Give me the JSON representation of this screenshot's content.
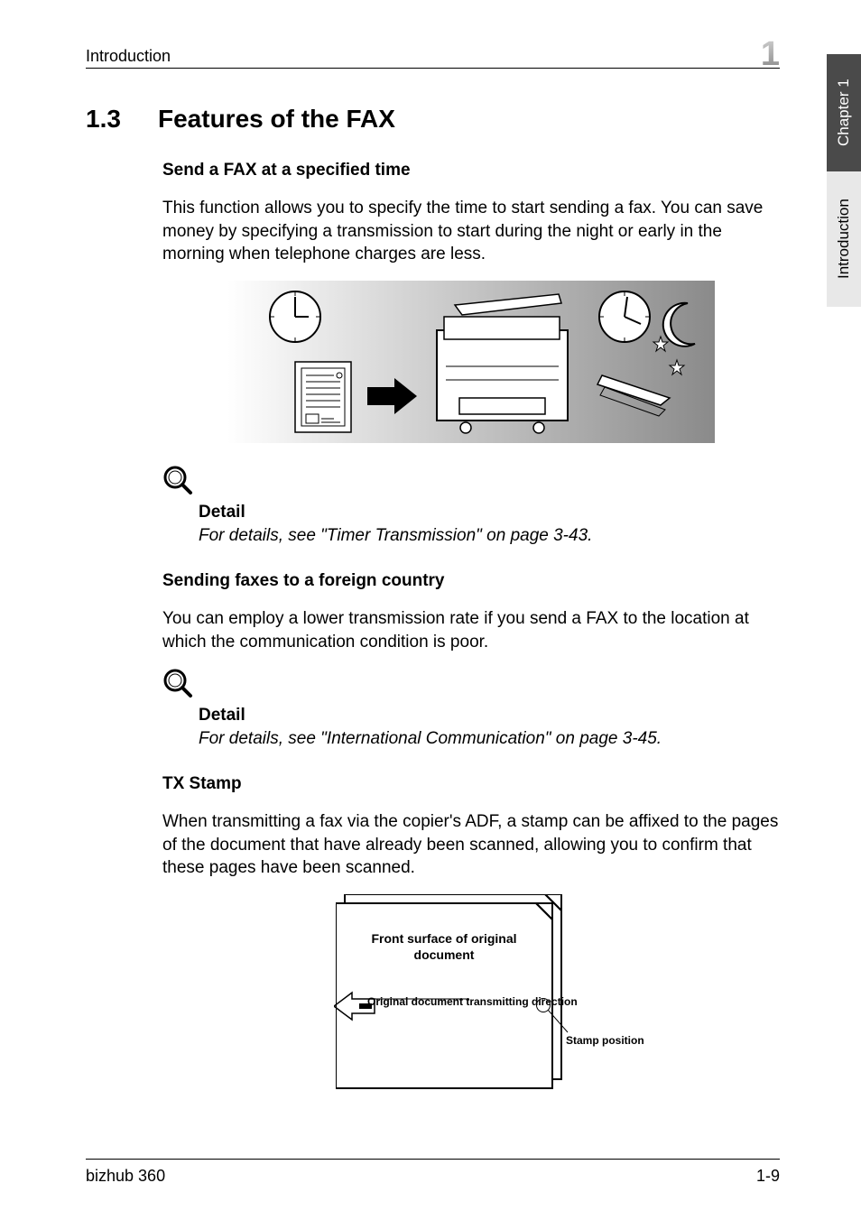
{
  "header": {
    "left": "Introduction",
    "right_number": "1"
  },
  "side_tabs": {
    "chapter": "Chapter 1",
    "section": "Introduction"
  },
  "section": {
    "number": "1.3",
    "title": "Features of the FAX"
  },
  "sub1": {
    "title": "Send a FAX at a specified time",
    "body": "This function allows you to specify the time to start sending a fax. You can save money by specifying a transmission to start during the night or early in the morning when telephone charges are less.",
    "detail_heading": "Detail",
    "detail_text": "For details, see \"Timer Transmission\" on page 3-43."
  },
  "sub2": {
    "title": "Sending faxes to a foreign country",
    "body": "You can employ a lower transmission rate if you send a FAX to the location at which the communication condition is poor.",
    "detail_heading": "Detail",
    "detail_text": "For details, see \"International Communication\" on page 3-45."
  },
  "sub3": {
    "title": "TX Stamp",
    "body": "When transmitting a fax via the copier's ADF, a stamp can be affixed to the pages of the document that have already been scanned, allowing you to confirm that these pages have been scanned.",
    "labels": {
      "front_surface": "Front surface of original document",
      "direction": "Original document transmitting direction",
      "stamp_position": "Stamp position"
    }
  },
  "footer": {
    "left": "bizhub 360",
    "right": "1-9"
  }
}
